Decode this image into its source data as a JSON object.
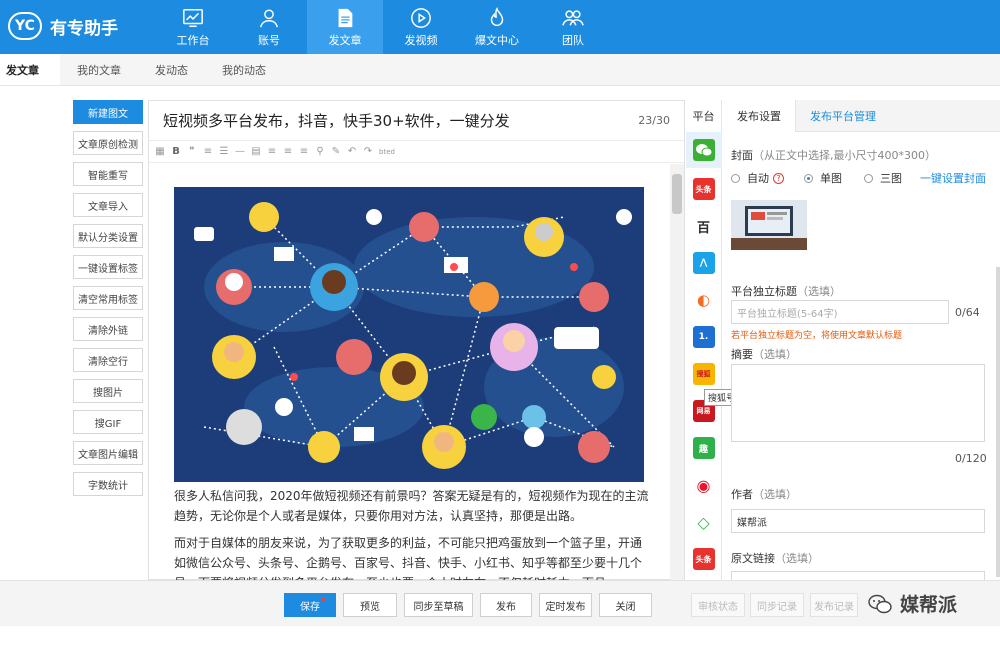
{
  "app": {
    "logo_mark": "YC",
    "name": "有专助手"
  },
  "nav": [
    {
      "label": "工作台",
      "icon": "dashboard-icon"
    },
    {
      "label": "账号",
      "icon": "user-icon"
    },
    {
      "label": "发文章",
      "icon": "document-icon"
    },
    {
      "label": "发视频",
      "icon": "play-icon"
    },
    {
      "label": "爆文中心",
      "icon": "fire-icon"
    },
    {
      "label": "团队",
      "icon": "team-icon"
    }
  ],
  "subtabs": [
    "发文章",
    "我的文章",
    "发动态",
    "我的动态"
  ],
  "tools": [
    "新建图文",
    "文章原创检测",
    "智能重写",
    "文章导入",
    "默认分类设置",
    "一键设置标签",
    "清空常用标签",
    "清除外链",
    "清除空行",
    "搜图片",
    "搜GIF",
    "文章图片编辑",
    "字数统计"
  ],
  "editor": {
    "title": "短视频多平台发布，抖音，快手30+软件，一键分发",
    "title_count": "23/30",
    "para1": "很多人私信问我，2020年做短视频还有前景吗？答案无疑是有的，短视频作为现在的主流趋势，无论你是个人或者是媒体，只要你用对方法，认真坚持，那便是出路。",
    "para2": "而对于自媒体的朋友来说，为了获取更多的利益，不可能只把鸡蛋放到一个篮子里，开通如微信公众号、头条号、企鹅号、百家号、抖音、快手、小红书、知乎等都至少要十几个号。而要将视频分发到多平台发布，至少也要一个小时左右，不仅耗时耗力，而且"
  },
  "platforms": {
    "header": "平台",
    "items": [
      {
        "name": "wechat-icon",
        "glyph": "",
        "color": "#3cb034"
      },
      {
        "name": "toutiao-icon",
        "glyph": "头条",
        "color": "#e8322d"
      },
      {
        "name": "baijia-icon",
        "glyph": "百",
        "color": "#2b2b2b"
      },
      {
        "name": "dayu-icon",
        "glyph": "⋀",
        "color": "#1aa3e8"
      },
      {
        "name": "qiehao-icon",
        "glyph": "◐",
        "color": "#f46d22"
      },
      {
        "name": "yidian-icon",
        "glyph": "1.",
        "color": "#1d6fd1"
      },
      {
        "name": "sohu-icon",
        "glyph": "搜狐",
        "color": "#f7b500"
      },
      {
        "name": "wangyi-icon",
        "glyph": "网易",
        "color": "#c9191e"
      },
      {
        "name": "qutoutiao-icon",
        "glyph": "趣",
        "color": "#2fb04a"
      },
      {
        "name": "weibo-icon",
        "glyph": "◉",
        "color": "#e6162d"
      },
      {
        "name": "bilibili-icon",
        "glyph": "◇",
        "color": "#3ab54a"
      },
      {
        "name": "toutiao2-icon",
        "glyph": "头条",
        "color": "#e8322d"
      }
    ],
    "tooltip": "搜狐号"
  },
  "right_panel": {
    "tabs": [
      "发布设置",
      "发布平台管理"
    ],
    "cover_label": "封面",
    "cover_hint": "（从正文中选择,最小尺寸400*300）",
    "cover_options": {
      "auto": "自动",
      "single": "单图",
      "triple": "三图"
    },
    "cover_link": "一键设置封面",
    "subtitle_label": "平台独立标题",
    "optional": "（选填）",
    "subtitle_placeholder": "平台独立标题(5-64字)",
    "subtitle_count": "0/64",
    "subtitle_warn": "若平台独立标题为空，将使用文章默认标题",
    "summary_label": "摘要",
    "summary_count": "0/120",
    "author_label": "作者",
    "author_value": "媒帮派",
    "source_label": "原文链接"
  },
  "bottom": {
    "save": "保存",
    "preview": "预览",
    "sync": "同步至草稿",
    "publish": "发布",
    "scheduled": "定时发布",
    "close": "关闭",
    "review_status": "审核状态",
    "sync_log": "同步记录",
    "publish_log": "发布记录"
  },
  "watermark": "媒帮派",
  "colors": {
    "brand": "#1d8ce0",
    "warning": "#e4580b"
  }
}
